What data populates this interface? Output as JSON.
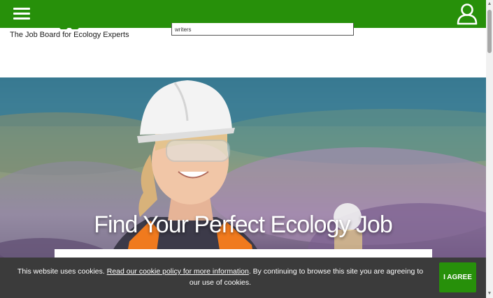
{
  "header": {
    "menu_icon": "hamburger-menu-icon",
    "account_icon": "user-account-icon",
    "tagline": "The Job Board for Ecology Experts",
    "search_value": "writers",
    "brand_color": "#27900a"
  },
  "hero": {
    "title": "Find Your Perfect Ecology Job"
  },
  "cookie_banner": {
    "text_before": "This website uses cookies. ",
    "link_text": "Read our cookie policy for more information",
    "text_after": ". By continuing to browse this site you are agreeing to our use of cookies.",
    "agree_label": "I AGREE",
    "background_color": "#3b3b3b"
  }
}
